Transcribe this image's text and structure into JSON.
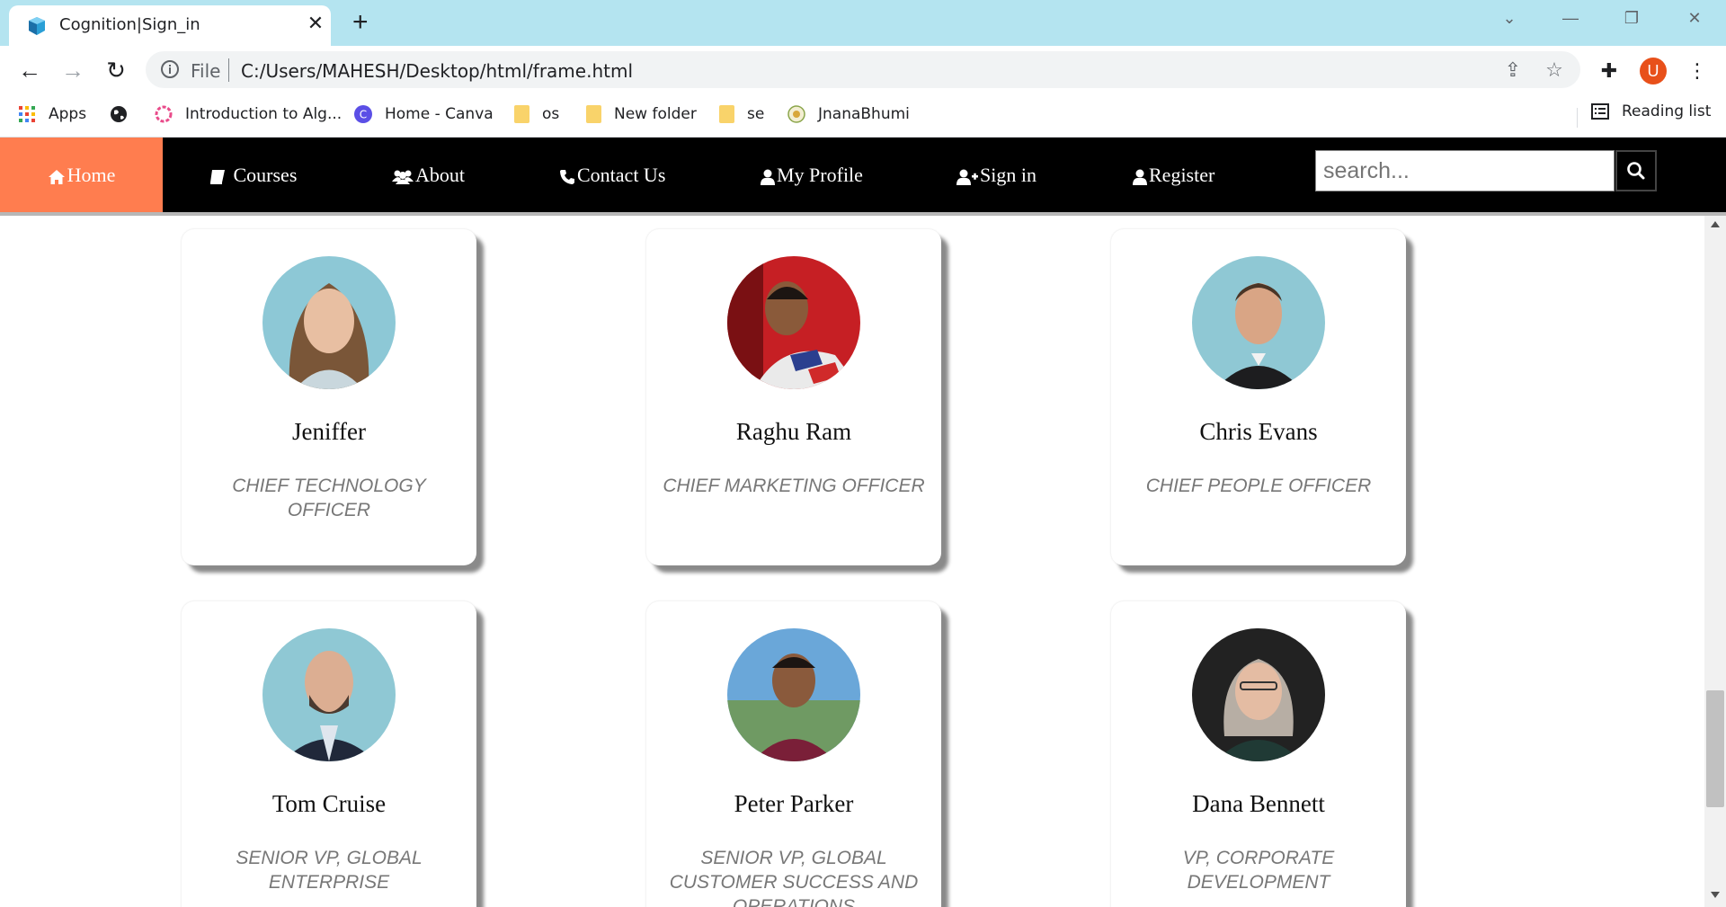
{
  "browser": {
    "tab_title": "Cognition|Sign_in",
    "new_tab_symbol": "+",
    "url_scheme_label": "File",
    "url": "C:/Users/MAHESH/Desktop/html/frame.html",
    "profile_initial": "U",
    "bookmarks": [
      {
        "label": "Apps",
        "icon": "apps-grid-icon"
      },
      {
        "label": "",
        "icon": "globe-icon"
      },
      {
        "label": "Introduction to Alg...",
        "icon": "coursera-icon"
      },
      {
        "label": "Home - Canva",
        "icon": "canva-icon"
      },
      {
        "label": "os",
        "icon": "folder-icon"
      },
      {
        "label": "New folder",
        "icon": "folder-icon"
      },
      {
        "label": "se",
        "icon": "folder-icon"
      },
      {
        "label": "JnanaBhumi",
        "icon": "jnanabhumi-icon"
      }
    ],
    "reading_list": "Reading list"
  },
  "nav": {
    "items": [
      {
        "label": "Home",
        "icon": "home-icon",
        "active": true
      },
      {
        "label": " Courses",
        "icon": "book-icon"
      },
      {
        "label": "About",
        "icon": "users-icon"
      },
      {
        "label": "Contact Us",
        "icon": "phone-icon"
      },
      {
        "label": "My Profile",
        "icon": "user-icon"
      },
      {
        "label": "Sign in",
        "icon": "user-plus-icon"
      },
      {
        "label": "Register",
        "icon": "user-icon"
      }
    ],
    "search_placeholder": "search...",
    "active_color": "#ff7d4f"
  },
  "team": [
    {
      "name": "Jeniffer",
      "role": "CHIEF TECHNOLOGY OFFICER"
    },
    {
      "name": "Raghu Ram",
      "role": "CHIEF MARKETING OFFICER"
    },
    {
      "name": "Chris Evans",
      "role": "CHIEF PEOPLE OFFICER"
    },
    {
      "name": "Tom Cruise",
      "role": "SENIOR VP, GLOBAL ENTERPRISE"
    },
    {
      "name": "Peter Parker",
      "role": "SENIOR VP, GLOBAL CUSTOMER SUCCESS AND OPERATIONS"
    },
    {
      "name": "Dana Bennett",
      "role": "VP, CORPORATE DEVELOPMENT"
    }
  ]
}
